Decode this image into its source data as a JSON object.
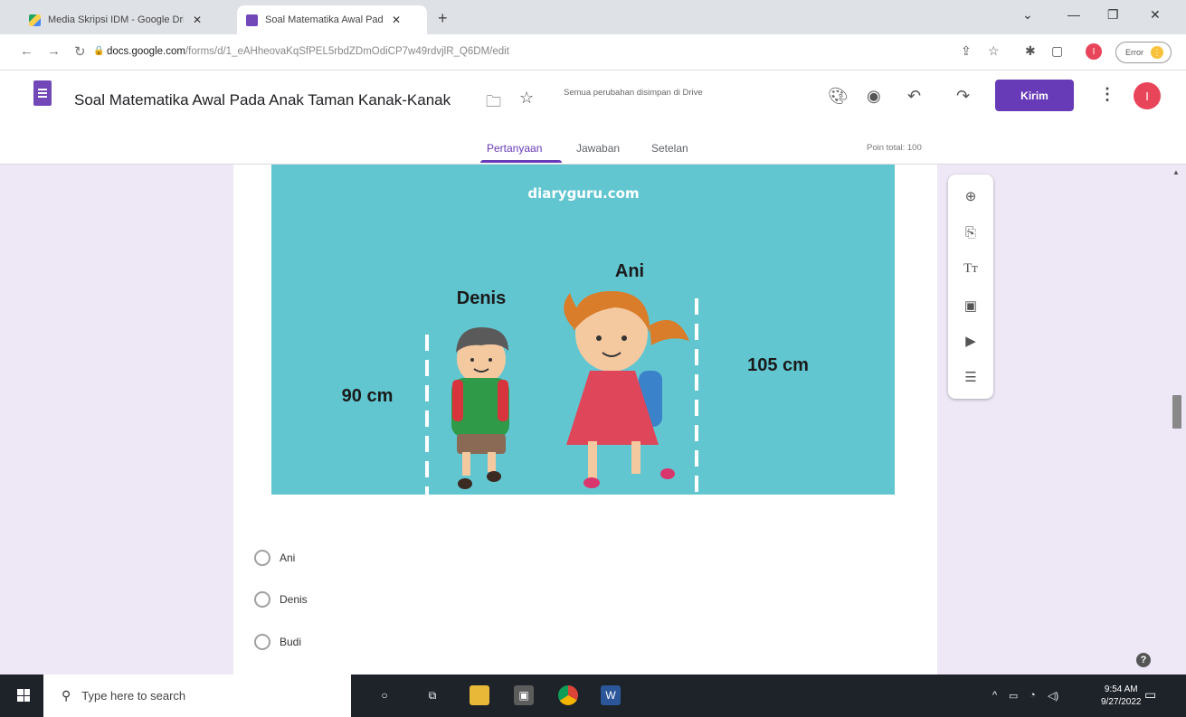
{
  "browser": {
    "tabs": [
      {
        "title": "Media Skripsi IDM - Google Driv",
        "favicon": "google-drive-icon",
        "active": false
      },
      {
        "title": "Soal Matematika Awal Pada Anal",
        "favicon": "google-forms-icon",
        "active": true
      }
    ],
    "url": {
      "host": "docs.google.com",
      "path": "/forms/d/1_eAHheovaKqSfPEL5rbdZDmOdiCP7w49rdvjlR_Q6DM/edit"
    },
    "error_label": "Error",
    "profile_initial": "I"
  },
  "form_header": {
    "title": "Soal Matematika Awal Pada Anak Taman Kanak-Kanak",
    "save_status": "Semua perubahan disimpan di Drive",
    "send_label": "Kirim",
    "avatar_initial": "I",
    "tabs": [
      "Pertanyaan",
      "Jawaban",
      "Setelan"
    ],
    "active_tab": "Pertanyaan",
    "points_total": "Poin total: 100"
  },
  "question_image": {
    "watermark": "diaryguru.com",
    "left_name": "Denis",
    "right_name": "Ani",
    "left_height": "90 cm",
    "right_height": "105 cm",
    "background_color": "#62c6d0"
  },
  "options": [
    {
      "label": "Ani"
    },
    {
      "label": "Denis"
    },
    {
      "label": "Budi"
    }
  ],
  "toolbar": [
    "add-question-icon",
    "import-questions-icon",
    "add-title-icon",
    "add-image-icon",
    "add-video-icon",
    "add-section-icon"
  ],
  "taskbar": {
    "search_placeholder": "Type here to search",
    "time": "9:54 AM",
    "date": "9/27/2022"
  },
  "colors": {
    "accent": "#673ab7",
    "background": "#ede7f6",
    "avatar": "#e8445a"
  }
}
